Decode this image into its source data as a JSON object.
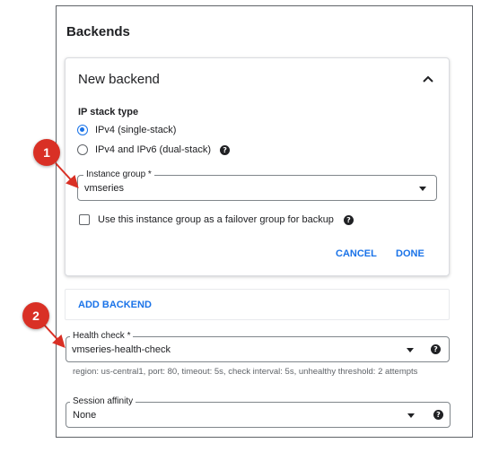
{
  "panel": {
    "title": "Backends"
  },
  "new_backend": {
    "title": "New backend",
    "ip_stack_label": "IP stack type",
    "ip_options": [
      "IPv4 (single-stack)",
      "IPv4 and IPv6 (dual-stack)"
    ],
    "ip_selected_index": 0,
    "instance_group": {
      "label": "Instance group *",
      "value": "vmseries"
    },
    "failover_label": "Use this instance group as a failover group for backup",
    "failover_checked": false,
    "cancel_label": "CANCEL",
    "done_label": "DONE"
  },
  "add_backend_label": "ADD BACKEND",
  "health_check": {
    "label": "Health check *",
    "value": "vmseries-health-check",
    "hint": "region: us-central1, port: 80, timeout: 5s, check interval: 5s, unhealthy threshold: 2 attempts"
  },
  "session_affinity": {
    "label": "Session affinity",
    "value": "None"
  },
  "callouts": [
    "1",
    "2"
  ],
  "colors": {
    "accent": "#1a73e8",
    "callout": "#d93025",
    "text": "#202124"
  },
  "icons": {
    "collapse": "chevron-up-icon",
    "dropdown": "caret-down-icon",
    "help": "help-circle-icon"
  }
}
